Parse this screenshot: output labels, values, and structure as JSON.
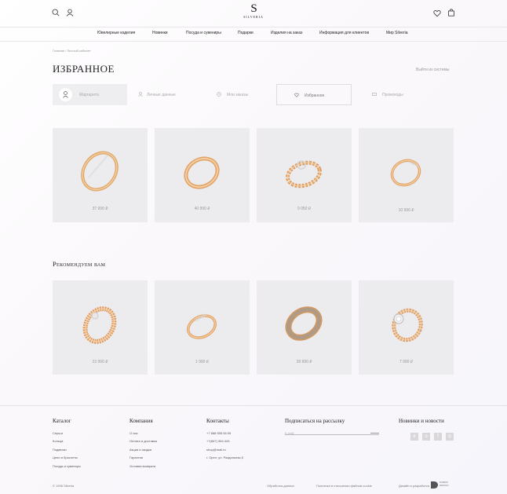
{
  "header": {
    "logo_mark": "S",
    "logo_text": "SILVERIA"
  },
  "nav": {
    "items": [
      "Ювелирные изделия",
      "Новинки",
      "Посуда и сувениры",
      "Подарки",
      "Изделия на заказ",
      "Информация для клиентов",
      "Мир Silveria"
    ]
  },
  "breadcrumb": "Главная  /  Личный кабинет",
  "page": {
    "title": "Избранное",
    "logout": "Выйти из системы"
  },
  "tabs": [
    "Маргарита",
    "Личные данные",
    "Мои заказы",
    "Избранное",
    "Промокоды"
  ],
  "favorites": [
    {
      "price": "37 990 ₽"
    },
    {
      "price": "40 990 ₽"
    },
    {
      "price": "9 050 ₽"
    },
    {
      "price": "10 990 ₽"
    }
  ],
  "recommend": {
    "title": "Рекомендуем вам",
    "items": [
      {
        "price": "23 990 ₽"
      },
      {
        "price": "1 990 ₽"
      },
      {
        "price": "28 990 ₽"
      },
      {
        "price": "7 990 ₽"
      }
    ]
  },
  "footer": {
    "catalog_title": "Каталог",
    "catalog": [
      "Серьги",
      "Кольца",
      "Подвески",
      "Цепи и браслеты",
      "Посуда и сувениры"
    ],
    "company_title": "Компания",
    "company": [
      "О нас",
      "Оплата и доставка",
      "Акции и скидки",
      "Гарантии",
      "Условия возврата"
    ],
    "contacts_title": "Контакты",
    "contacts": [
      "+7 888 555 55 55",
      "+7(667) 384 443",
      "shop@mail.ru",
      "г. Орел, ул. Раздольная,5"
    ],
    "subscribe_title": "Подписаться на рассылку",
    "email_placeholder": "E-mail",
    "news_title": "Новинки и новости",
    "copyright": "© 1996 Silveria",
    "privacy": "Обработка данных",
    "cookies": "Политика в отношении файлов cookie",
    "design": "Дизайн и разработка",
    "studio": "DOBRO DESIGN"
  }
}
